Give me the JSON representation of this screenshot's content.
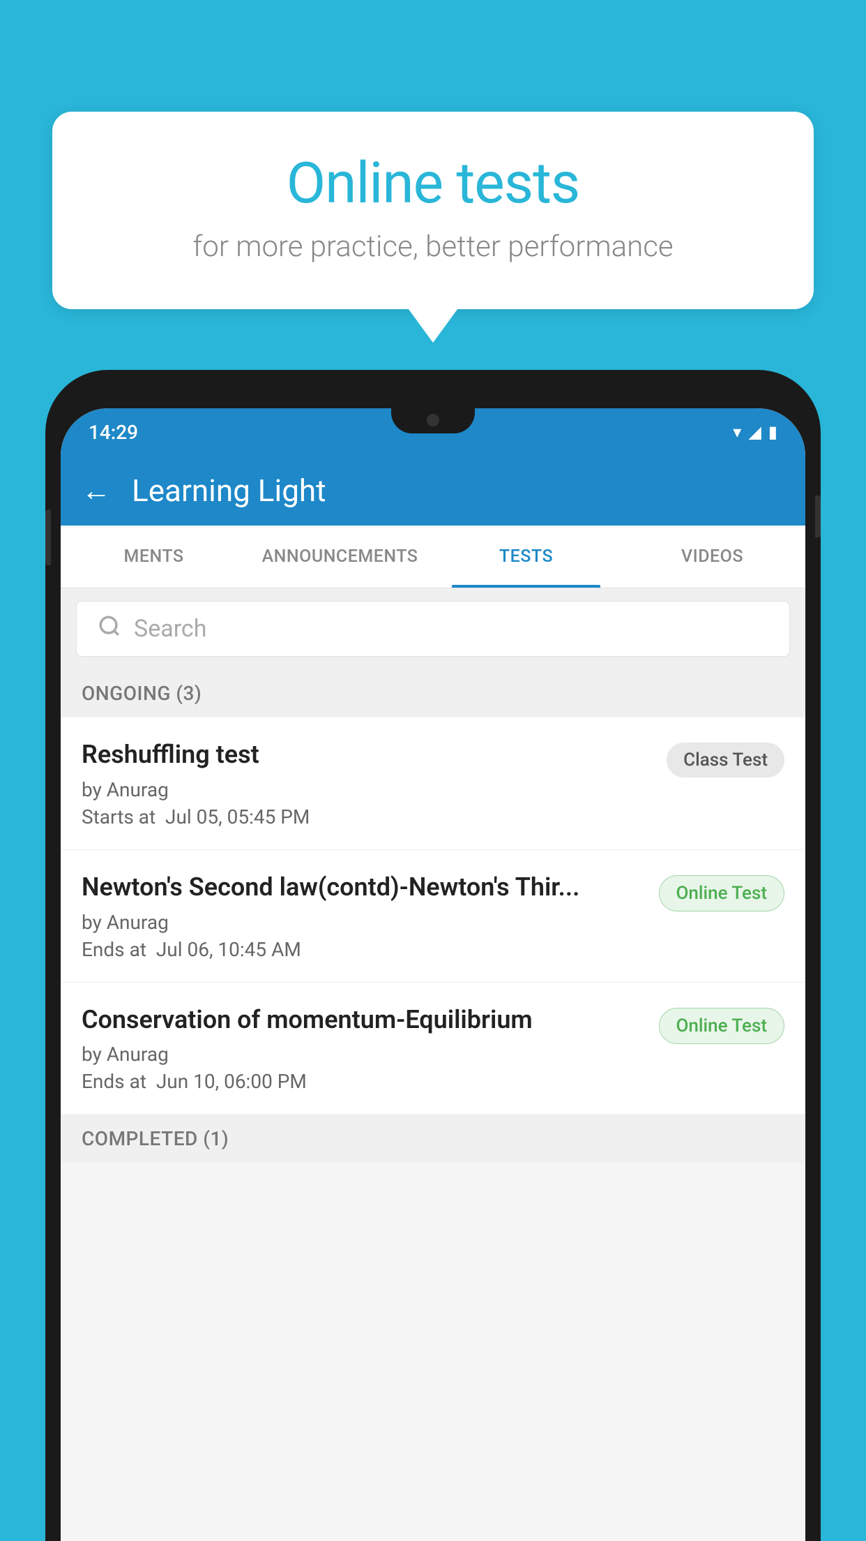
{
  "background": {
    "color": "#29b6d8"
  },
  "speech_bubble": {
    "title": "Online tests",
    "subtitle": "for more practice, better performance"
  },
  "phone": {
    "status_bar": {
      "time": "14:29",
      "wifi": "▾",
      "signal": "◢",
      "battery": "▮"
    },
    "app_bar": {
      "title": "Learning Light",
      "back_label": "←"
    },
    "tabs": [
      {
        "label": "MENTS",
        "active": false
      },
      {
        "label": "ANNOUNCEMENTS",
        "active": false
      },
      {
        "label": "TESTS",
        "active": true
      },
      {
        "label": "VIDEOS",
        "active": false
      }
    ],
    "search": {
      "placeholder": "Search"
    },
    "ongoing_section": {
      "title": "ONGOING (3)"
    },
    "tests": [
      {
        "name": "Reshuffling test",
        "author": "by Anurag",
        "time_label": "Starts at",
        "time": "Jul 05, 05:45 PM",
        "badge": "Class Test",
        "badge_type": "class"
      },
      {
        "name": "Newton's Second law(contd)-Newton's Thir...",
        "author": "by Anurag",
        "time_label": "Ends at",
        "time": "Jul 06, 10:45 AM",
        "badge": "Online Test",
        "badge_type": "online"
      },
      {
        "name": "Conservation of momentum-Equilibrium",
        "author": "by Anurag",
        "time_label": "Ends at",
        "time": "Jun 10, 06:00 PM",
        "badge": "Online Test",
        "badge_type": "online"
      }
    ],
    "completed_section": {
      "title": "COMPLETED (1)"
    }
  }
}
